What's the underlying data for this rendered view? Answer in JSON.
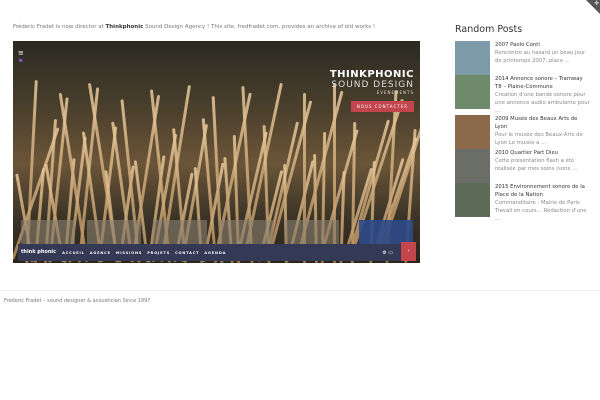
{
  "intro": {
    "pre": "Fréderic Fradet is now director at ",
    "brand": "Thinkphonic",
    "post": " Sound Design Agency ! This site, fredfradet.com, provides an archive of old works !"
  },
  "hero": {
    "brand_line1": "THINKPHONIC",
    "brand_line2": "SOUND DESIGN",
    "brand_line3": "EVENEMENTS",
    "contact_button": "NOUS CONTACTER",
    "logo": "think phonic",
    "nav": [
      "ACCUEIL",
      "AGENCE",
      "MISSIONS",
      "PROJETS",
      "CONTACT",
      "AGENDA"
    ]
  },
  "sidebar": {
    "title": "Random Posts",
    "posts": [
      {
        "title": "2007 Paolo Conti",
        "excerpt": "Rencontre au hasard un beau jour de printemps 2007, place …",
        "color": "#7d9aa8"
      },
      {
        "title": "2014 Annonce sonore – Tramway T8 – Plaine-Commune",
        "excerpt": "Creation d'une bande sonore pour une annonce audio ambulante pour …",
        "color": "#6f8a6a"
      },
      {
        "title": "2009 Musée des Beaux Arts de Lyon",
        "excerpt": "Pour le musée des Beaux-Arts de Lyon Le musée a …",
        "color": "#8a6a4a"
      },
      {
        "title": "2010 Quartier Part Dieu",
        "excerpt": "Cette présentation flash a été réalisée par mes soins (sons …",
        "color": "#6a6e66"
      },
      {
        "title": "2015 Environnement sonore de la Place de la Nation",
        "excerpt": "Commanditaire : Mairie de Paris Travail en cours… Rédaction d'une …",
        "color": "#5d6a58"
      }
    ]
  },
  "footer": "Fréderic Fradet – sound designer & acoustician Since 1997"
}
